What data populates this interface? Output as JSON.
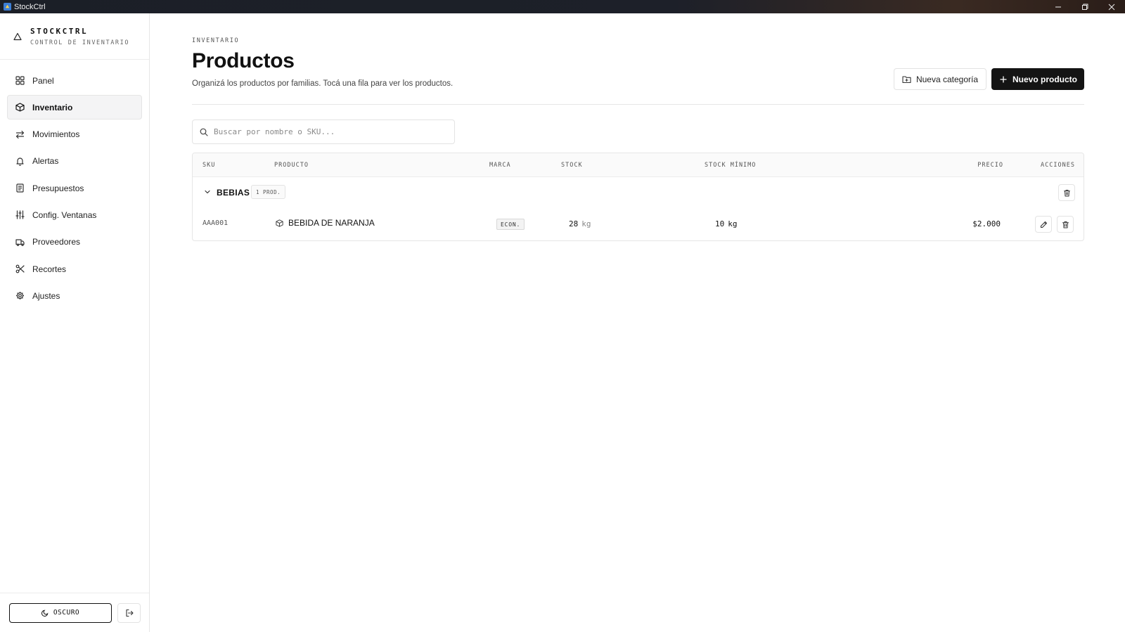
{
  "window": {
    "title": "StockCtrl"
  },
  "sidebar": {
    "brand_name": "STOCKCTRL",
    "brand_sub": "CONTROL DE INVENTARIO",
    "items": [
      {
        "label": "Panel",
        "icon": "grid-icon"
      },
      {
        "label": "Inventario",
        "icon": "box-icon",
        "active": true
      },
      {
        "label": "Movimientos",
        "icon": "arrows-swap-icon"
      },
      {
        "label": "Alertas",
        "icon": "bell-icon"
      },
      {
        "label": "Presupuestos",
        "icon": "document-icon"
      },
      {
        "label": "Config. Ventanas",
        "icon": "sliders-icon"
      },
      {
        "label": "Proveedores",
        "icon": "truck-icon"
      },
      {
        "label": "Recortes",
        "icon": "scissors-icon"
      },
      {
        "label": "Ajustes",
        "icon": "gear-icon"
      }
    ],
    "theme_label": "OSCURO"
  },
  "header": {
    "eyebrow": "INVENTARIO",
    "title": "Productos",
    "description": "Organizá los productos por familias. Tocá una fila para ver los productos.",
    "new_category_label": "Nueva categoría",
    "new_product_label": "Nuevo producto"
  },
  "search": {
    "placeholder": "Buscar por nombre o SKU..."
  },
  "table": {
    "columns": {
      "sku": "SKU",
      "product": "PRODUCTO",
      "brand": "MARCA",
      "stock": "STOCK",
      "min_stock": "STOCK MÍNIMO",
      "price": "PRECIO",
      "actions": "ACCIONES"
    },
    "groups": [
      {
        "name": "BEBIAS",
        "count": "1 PROD.",
        "rows": [
          {
            "sku": "AAA001",
            "product": "BEBIDA DE NARANJA",
            "brand": "ECON.",
            "stock": "28",
            "stock_unit": "kg",
            "min_stock": "10",
            "min_stock_unit": "kg",
            "price": "$2.000"
          }
        ]
      }
    ]
  },
  "colors": {
    "primary": "#141414",
    "border": "#e3e3e3",
    "active_bg": "#f4f4f5"
  }
}
